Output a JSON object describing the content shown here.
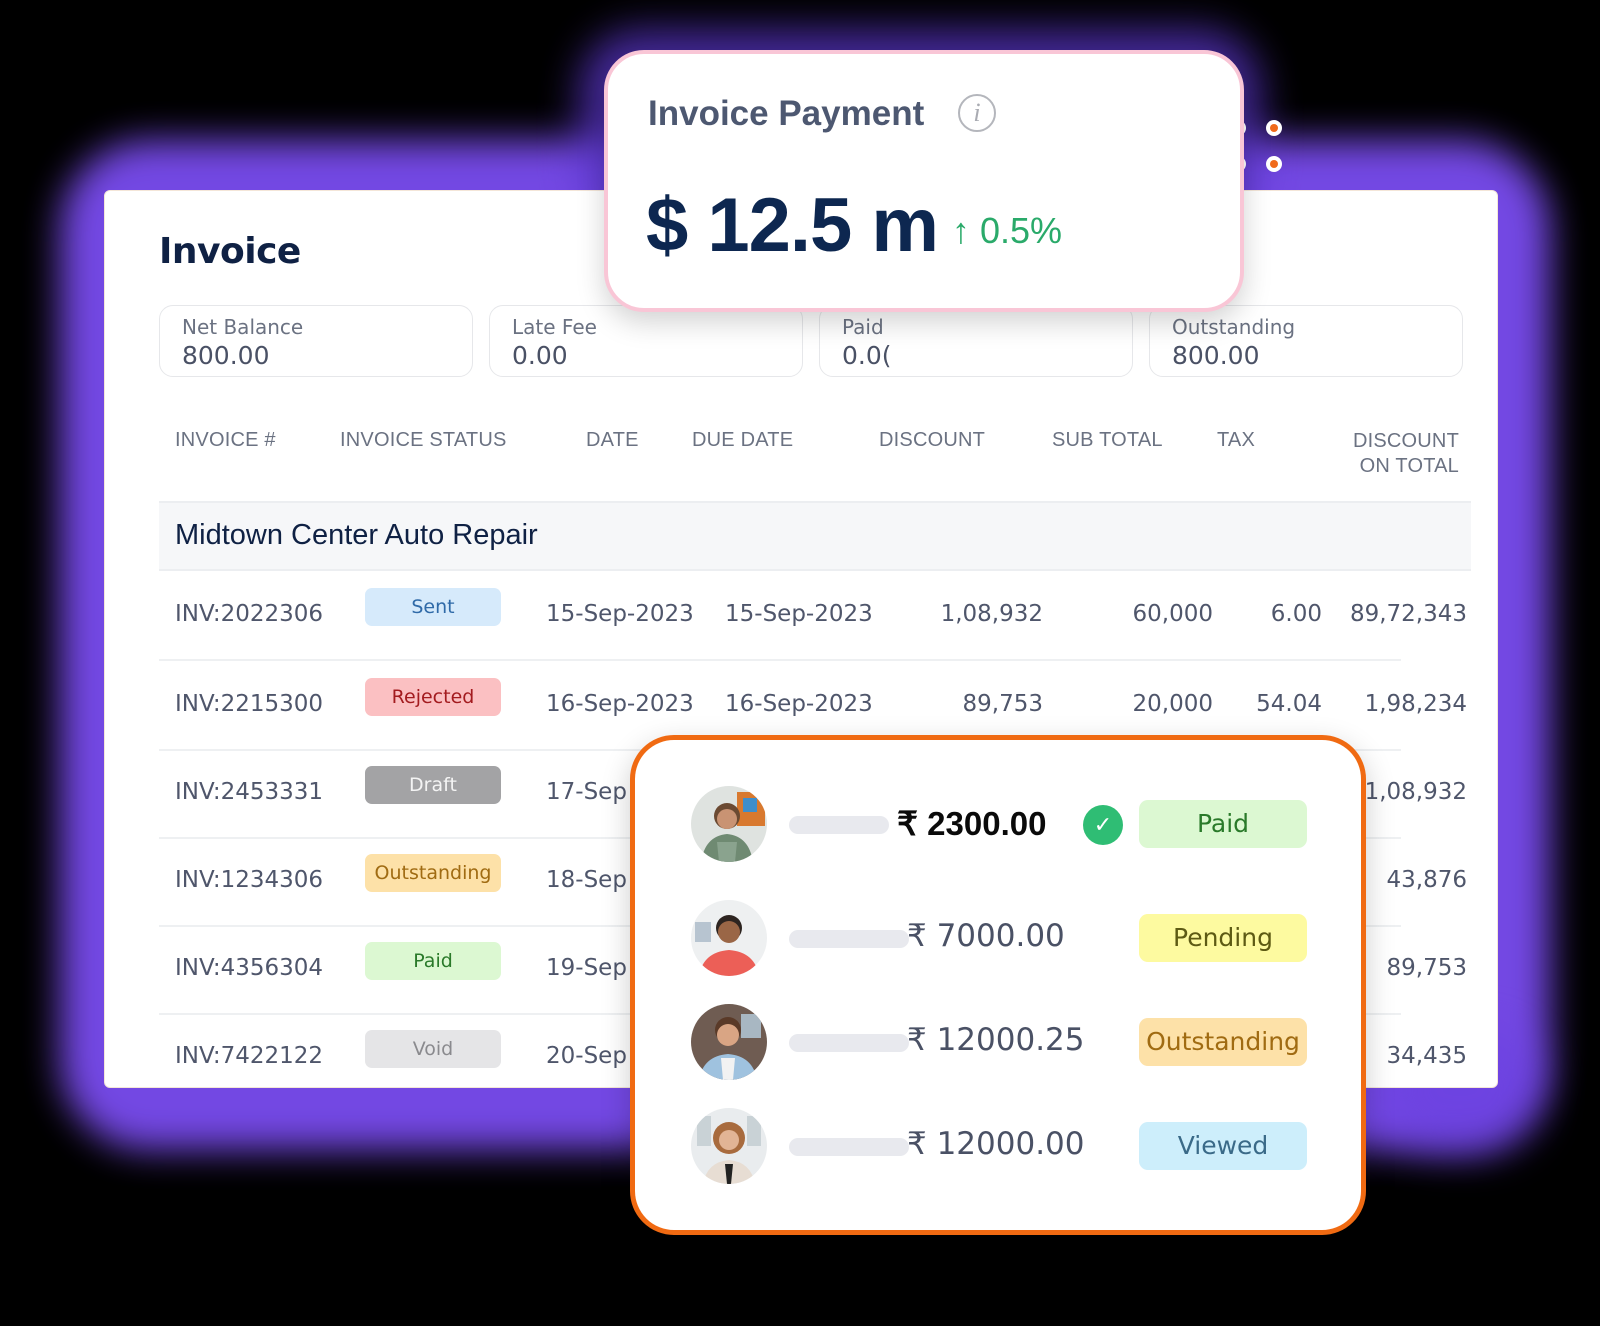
{
  "invoice_panel": {
    "title": "Invoice",
    "summary": [
      {
        "label": "Net Balance",
        "value": "800.00"
      },
      {
        "label": "Late Fee",
        "value": "0.00"
      },
      {
        "label": "Paid",
        "value": "0.0("
      },
      {
        "label": "Outstanding",
        "value": "800.00"
      }
    ],
    "columns": [
      "INVOICE #",
      "INVOICE STATUS",
      "DATE",
      "DUE DATE",
      "DISCOUNT",
      "SUB TOTAL",
      "TAX",
      "DISCOUNT",
      "ON TOTAL"
    ],
    "group_name": "Midtown Center Auto Repair",
    "rows": [
      {
        "invoice": "INV:2022306",
        "status": "Sent",
        "date": "15-Sep-2023",
        "due_date": "15-Sep-2023",
        "discount": "1,08,932",
        "sub_total": "60,000",
        "tax": "6.00",
        "discount_on_total": "89,72,343"
      },
      {
        "invoice": "INV:2215300",
        "status": "Rejected",
        "date": "16-Sep-2023",
        "due_date": "16-Sep-2023",
        "discount": "89,753",
        "sub_total": "20,000",
        "tax": "54.04",
        "discount_on_total": "1,98,234"
      },
      {
        "invoice": "INV:2453331",
        "status": "Draft",
        "date": "17-Sep",
        "due_date": "",
        "discount": "",
        "sub_total": "",
        "tax": "",
        "discount_on_total": "1,08,932"
      },
      {
        "invoice": "INV:1234306",
        "status": "Outstanding",
        "date": "18-Sep",
        "due_date": "",
        "discount": "",
        "sub_total": "",
        "tax": "",
        "discount_on_total": "43,876"
      },
      {
        "invoice": "INV:4356304",
        "status": "Paid",
        "date": "19-Sep",
        "due_date": "",
        "discount": "",
        "sub_total": "",
        "tax": "",
        "discount_on_total": "89,753"
      },
      {
        "invoice": "INV:7422122",
        "status": "Void",
        "date": "20-Sep",
        "due_date": "",
        "discount": "",
        "sub_total": "",
        "tax": "",
        "discount_on_total": "34,435"
      }
    ],
    "status_colors": {
      "Sent": {
        "bg": "#d6eafb",
        "fg": "#2f6aa8"
      },
      "Rejected": {
        "bg": "#fbc0c2",
        "fg": "#a31b1f"
      },
      "Draft": {
        "bg": "#a3a3a5",
        "fg": "#f4f4f4"
      },
      "Outstanding": {
        "bg": "#fde1a8",
        "fg": "#a06b12"
      },
      "Paid": {
        "bg": "#dcf8d2",
        "fg": "#2a7a2a"
      },
      "Void": {
        "bg": "#e5e5e7",
        "fg": "#8a8a8e"
      }
    }
  },
  "payment_card": {
    "title": "Invoice Payment",
    "info_icon": "info-icon",
    "amount": "$ 12.5 m",
    "change": "↑ 0.5%",
    "change_color": "#2aaa6a"
  },
  "payments_list": {
    "items": [
      {
        "amount": "₹ 2300.00",
        "status": "Paid",
        "verified": true,
        "bg": "#dcf8d2",
        "fg": "#2a7a2a"
      },
      {
        "amount": "₹ 7000.00",
        "status": "Pending",
        "verified": false,
        "bg": "#fdfaa0",
        "fg": "#5d5a14"
      },
      {
        "amount": "₹ 12000.25",
        "status": "Outstanding",
        "verified": false,
        "bg": "#fde1a8",
        "fg": "#a06b12"
      },
      {
        "amount": "₹ 12000.00",
        "status": "Viewed",
        "verified": false,
        "bg": "#cdeefb",
        "fg": "#3a6a88"
      }
    ],
    "check_icon": "✓"
  },
  "accent_colors": {
    "glow": "#7a4cf0",
    "payment_card_border": "#f9c6d6",
    "list_card_border": "#f06a12"
  }
}
